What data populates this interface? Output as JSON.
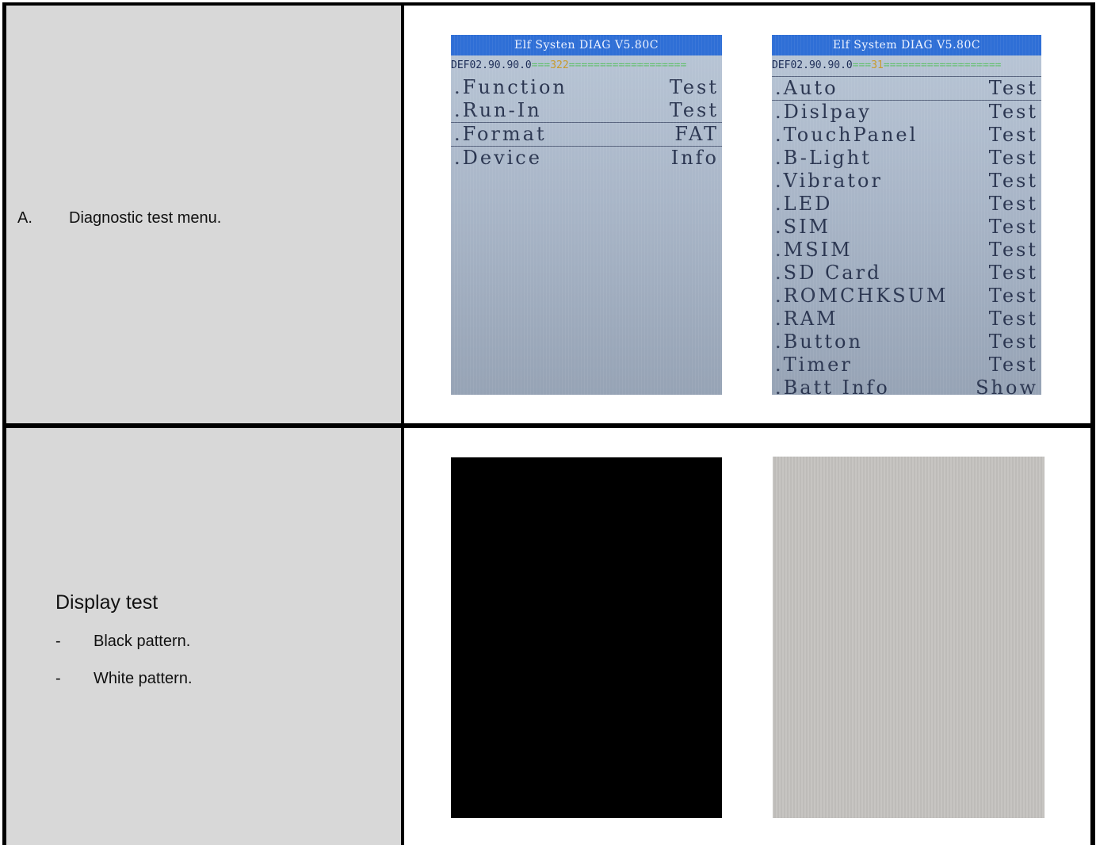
{
  "row1": {
    "label_num": "A.",
    "label_text": "Diagnostic test menu.",
    "screen1": {
      "header": "Elf Systen DIAG V5.80C",
      "status_id": "DEF02.90.90.0",
      "status_count": "322",
      "items": [
        {
          "label": ".Function",
          "value": "Test"
        },
        {
          "label": ".Run-In",
          "value": "Test"
        },
        {
          "label": ".Format",
          "value": "FAT"
        },
        {
          "label": ".Device",
          "value": "Info"
        }
      ]
    },
    "screen2": {
      "header": "Elf System DIAG V5.80C",
      "status_id": "DEF02.90.90.0",
      "status_count": "31",
      "items": [
        {
          "label": ".Auto",
          "value": "Test"
        },
        {
          "label": ".Dislpay",
          "value": "Test"
        },
        {
          "label": ".TouchPanel",
          "value": "Test"
        },
        {
          "label": ".B-Light",
          "value": "Test"
        },
        {
          "label": ".Vibrator",
          "value": "Test"
        },
        {
          "label": ".LED",
          "value": "Test"
        },
        {
          "label": ".SIM",
          "value": "Test"
        },
        {
          "label": ".MSIM",
          "value": "Test"
        },
        {
          "label": ".SD Card",
          "value": "Test"
        },
        {
          "label": ".ROMCHKSUM",
          "value": "Test"
        },
        {
          "label": ".RAM",
          "value": "Test"
        },
        {
          "label": ".Button",
          "value": "Test"
        },
        {
          "label": ".Timer",
          "value": "Test"
        },
        {
          "label": ".Batt Info",
          "value": "Show"
        }
      ]
    }
  },
  "row2": {
    "title": "Display test",
    "bullets": [
      "Black pattern.",
      "White pattern."
    ],
    "bullet_marker": "-"
  },
  "colors": {
    "cell_gray": "#d8d8d8",
    "border": "#000000",
    "lcd_header_blue": "#2f6fd6"
  }
}
